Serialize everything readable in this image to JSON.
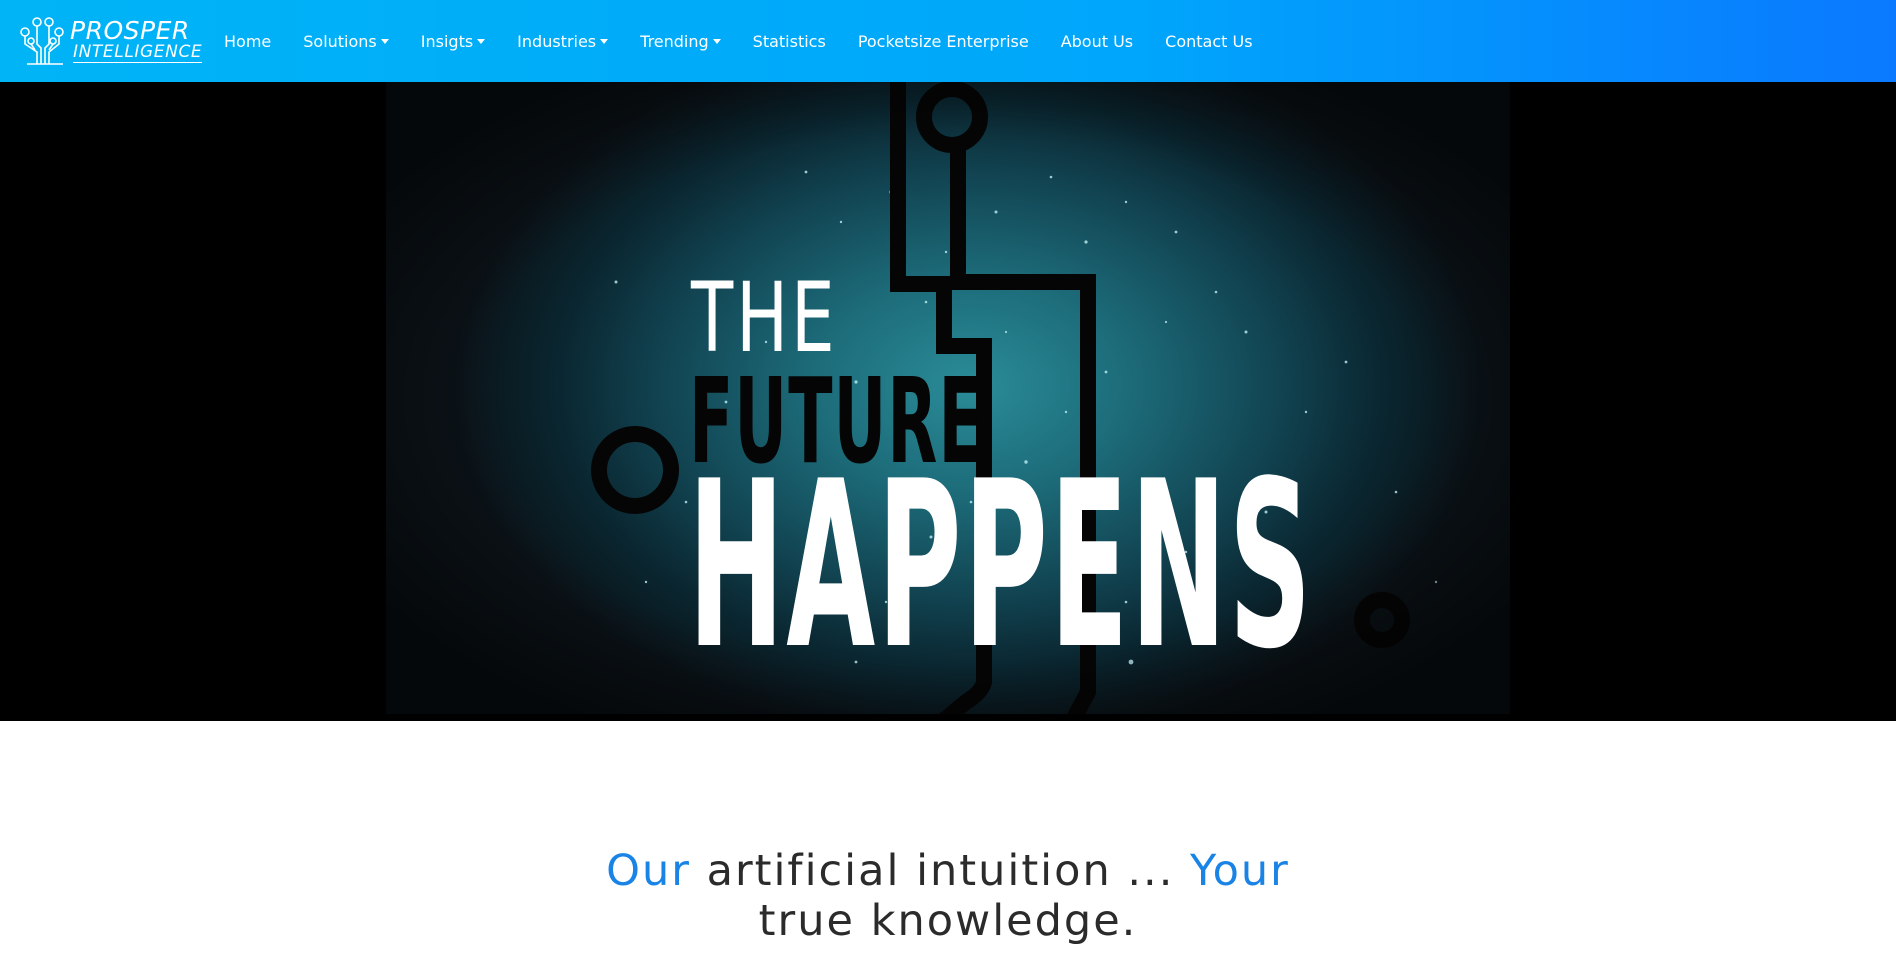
{
  "brand": {
    "logo_icon": "circuit-tree-logo",
    "line1": "PROSPER",
    "line2": "INTELLIGENCE"
  },
  "nav": {
    "items": [
      {
        "label": "Home",
        "dropdown": false
      },
      {
        "label": "Solutions",
        "dropdown": true
      },
      {
        "label": "Insigts",
        "dropdown": true
      },
      {
        "label": "Industries",
        "dropdown": true
      },
      {
        "label": "Trending",
        "dropdown": true
      },
      {
        "label": "Statistics",
        "dropdown": false
      },
      {
        "label": "Pocketsize Enterprise",
        "dropdown": false
      },
      {
        "label": "About Us",
        "dropdown": false
      },
      {
        "label": "Contact Us",
        "dropdown": false
      }
    ]
  },
  "hero": {
    "line1": "THE",
    "line2": "FUTURE",
    "line3": "HAPPENS"
  },
  "tagline": {
    "part1": "Our",
    "part2": " artificial intuition ... ",
    "part3": "Your",
    "part4": " true knowledge."
  },
  "colors": {
    "navbar_start": "#00b4f6",
    "navbar_end": "#0a79ff",
    "accent": "#1a83e6",
    "text": "#2b2b2b"
  }
}
